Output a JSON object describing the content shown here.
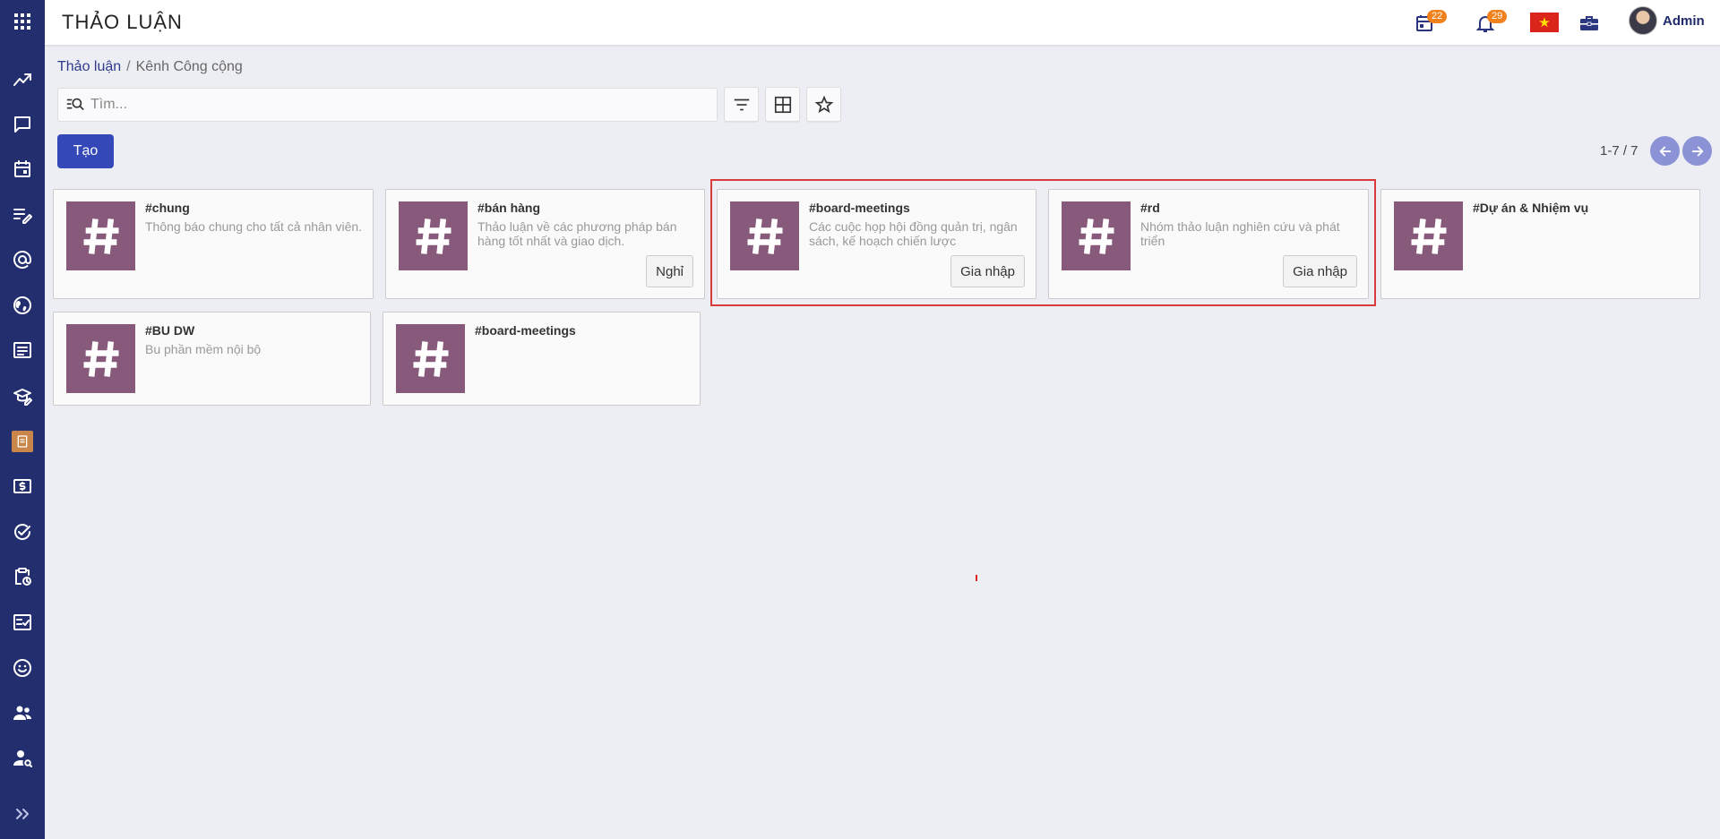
{
  "app": {
    "title": "THẢO LUẬN"
  },
  "sidebar": {
    "items": [
      {
        "icon": "apps-grid-icon"
      },
      {
        "icon": "trend-chart-icon"
      },
      {
        "icon": "chat-icon"
      },
      {
        "icon": "calendar-icon"
      },
      {
        "icon": "notes-edit-icon"
      },
      {
        "icon": "at-sign-icon"
      },
      {
        "icon": "globe-icon"
      },
      {
        "icon": "article-icon"
      },
      {
        "icon": "school-edit-icon"
      },
      {
        "icon": "document-app-icon"
      },
      {
        "icon": "money-icon"
      },
      {
        "icon": "check-circle-icon"
      },
      {
        "icon": "clipboard-clock-icon"
      },
      {
        "icon": "checklist-icon"
      },
      {
        "icon": "smiley-icon"
      },
      {
        "icon": "people-icon"
      },
      {
        "icon": "person-search-icon"
      },
      {
        "icon": "expand-chevrons-icon"
      }
    ]
  },
  "topbar": {
    "calendar_badge": "22",
    "notification_badge": "29",
    "language_flag": "vietnam-flag-icon",
    "user_name": "Admin"
  },
  "breadcrumb": {
    "parent": "Thảo luận",
    "separator": "/",
    "current": "Kênh Công cộng"
  },
  "search": {
    "placeholder": "Tìm...",
    "value": ""
  },
  "actions": {
    "create_label": "Tạo"
  },
  "pager": {
    "text": "1-7 / 7"
  },
  "channels": [
    {
      "name": "#chung",
      "description": "Thông báo chung cho tất cả nhân viên.",
      "button": ""
    },
    {
      "name": "#bán hàng",
      "description": "Thảo luận về các phương pháp bán hàng tốt nhất và giao dịch.",
      "button": "Nghỉ"
    },
    {
      "name": "#board-meetings",
      "description": "Các cuộc họp hội đồng quản trị, ngân sách, kế hoạch chiến lược",
      "button": "Gia nhập"
    },
    {
      "name": "#rd",
      "description": "Nhóm thảo luận nghiên cứu và phát triển",
      "button": "Gia nhập"
    },
    {
      "name": "#Dự án & Nhiệm vụ",
      "description": "",
      "button": ""
    },
    {
      "name": "#BU DW",
      "description": "Bu phần mềm nội bộ",
      "button": ""
    },
    {
      "name": "#board-meetings",
      "description": "",
      "button": ""
    }
  ],
  "colors": {
    "sidebar": "#232e6e",
    "primary": "#3448b8",
    "channel_image": "#875a7b",
    "badge": "#f0811c",
    "highlight": "#d93a3a"
  }
}
